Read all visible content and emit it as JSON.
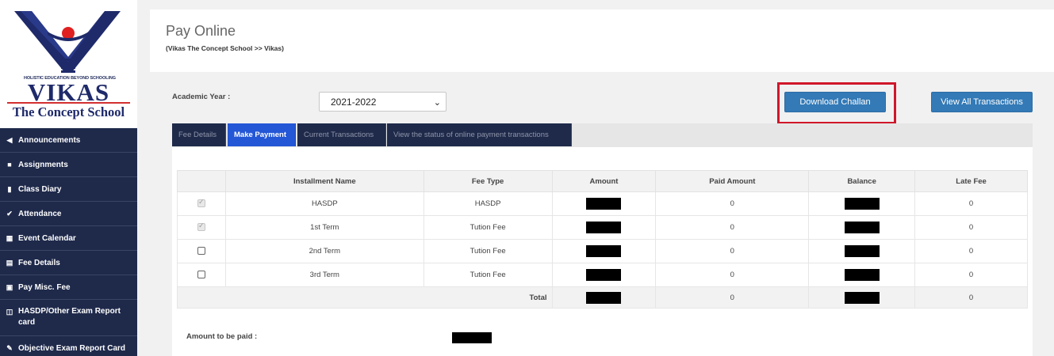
{
  "brand": {
    "tagline": "HOLISTIC EDUCATION BEYOND SCHOOLING",
    "name": "VIKAS",
    "subtitle": "The Concept School",
    "colors": {
      "navy": "#1f2a6a",
      "red": "#d32f2f"
    }
  },
  "sidebar": {
    "items": [
      {
        "icon": "megaphone-icon",
        "glyph": "◀",
        "label": "Announcements"
      },
      {
        "icon": "briefcase-icon",
        "glyph": "■",
        "label": "Assignments"
      },
      {
        "icon": "book-icon",
        "glyph": "▮",
        "label": "Class Diary"
      },
      {
        "icon": "check-icon",
        "glyph": "✔",
        "label": "Attendance"
      },
      {
        "icon": "calendar-icon",
        "glyph": "▦",
        "label": "Event Calendar"
      },
      {
        "icon": "fee-icon",
        "glyph": "▤",
        "label": "Fee Details"
      },
      {
        "icon": "money-icon",
        "glyph": "▣",
        "label": "Pay Misc. Fee"
      },
      {
        "icon": "report-icon",
        "glyph": "◫",
        "label": "HASDP/Other Exam Report card"
      },
      {
        "icon": "edit-icon",
        "glyph": "✎",
        "label": "Objective Exam Report Card"
      }
    ]
  },
  "header": {
    "title": "Pay Online",
    "breadcrumb": "(Vikas The Concept School >> Vikas)"
  },
  "controls": {
    "academic_year_label": "Academic Year :",
    "academic_year_value": "2021-2022",
    "download_challan": "Download Challan",
    "view_all_transactions": "View All Transactions"
  },
  "tabs": [
    {
      "label": "Fee Details",
      "active": false
    },
    {
      "label": "Make Payment",
      "active": true
    },
    {
      "label": "Current Transactions",
      "active": false
    },
    {
      "label": "View the status of online payment transactions",
      "active": false
    }
  ],
  "table": {
    "headers": [
      "Installment Name",
      "Fee Type",
      "Amount",
      "Paid Amount",
      "Balance",
      "Late Fee"
    ],
    "rows": [
      {
        "name": "HASDP",
        "fee_type": "HASDP",
        "paid": "0",
        "late_fee": "0",
        "checked": true,
        "disabled": true
      },
      {
        "name": "1st Term",
        "fee_type": "Tution Fee",
        "paid": "0",
        "late_fee": "0",
        "checked": true,
        "disabled": true
      },
      {
        "name": "2nd Term",
        "fee_type": "Tution Fee",
        "paid": "0",
        "late_fee": "0",
        "checked": false,
        "disabled": false
      },
      {
        "name": "3rd Term",
        "fee_type": "Tution Fee",
        "paid": "0",
        "late_fee": "0",
        "checked": false,
        "disabled": false
      }
    ],
    "total": {
      "label": "Total",
      "paid": "0",
      "late_fee": "0"
    }
  },
  "payment": {
    "amount_label": "Amount to be paid :"
  },
  "colors": {
    "sidebar_bg": "#1f2a4b",
    "accent_blue": "#337ab7",
    "active_tab": "#2457d6",
    "highlight_red": "#d0172a"
  }
}
